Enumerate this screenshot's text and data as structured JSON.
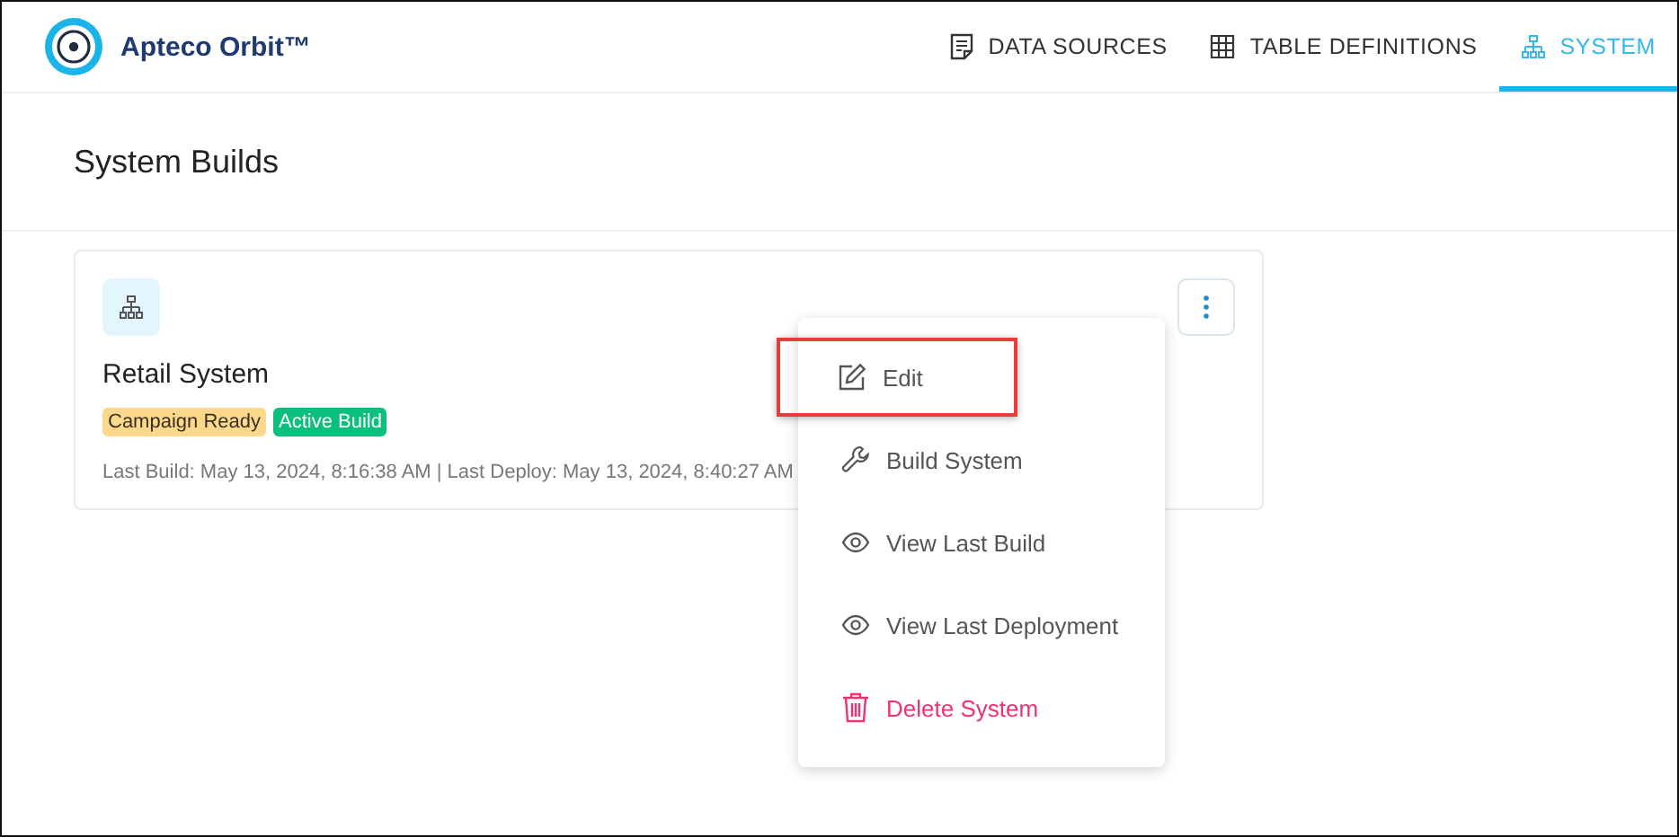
{
  "app": {
    "name": "Apteco Orbit™"
  },
  "tabs": [
    {
      "label": "DATA SOURCES",
      "selected": false
    },
    {
      "label": "TABLE DEFINITIONS",
      "selected": false
    },
    {
      "label": "SYSTEM",
      "selected": true
    }
  ],
  "page": {
    "title": "System Builds"
  },
  "card": {
    "name": "Retail System",
    "badges": [
      {
        "label": "Campaign Ready",
        "color": "#fcd88c"
      },
      {
        "label": "Active Build",
        "color": "#0bbf7c"
      }
    ],
    "meta": "Last Build: May 13, 2024, 8:16:38 AM | Last Deploy: May 13, 2024, 8:40:27 AM"
  },
  "menu": [
    {
      "label": "Edit",
      "kind": "normal",
      "highlighted": true
    },
    {
      "label": "Build System",
      "kind": "normal",
      "highlighted": false
    },
    {
      "label": "View Last Build",
      "kind": "normal",
      "highlighted": false
    },
    {
      "label": "View Last Deployment",
      "kind": "normal",
      "highlighted": false
    },
    {
      "label": "Delete System",
      "kind": "danger",
      "highlighted": false
    }
  ]
}
